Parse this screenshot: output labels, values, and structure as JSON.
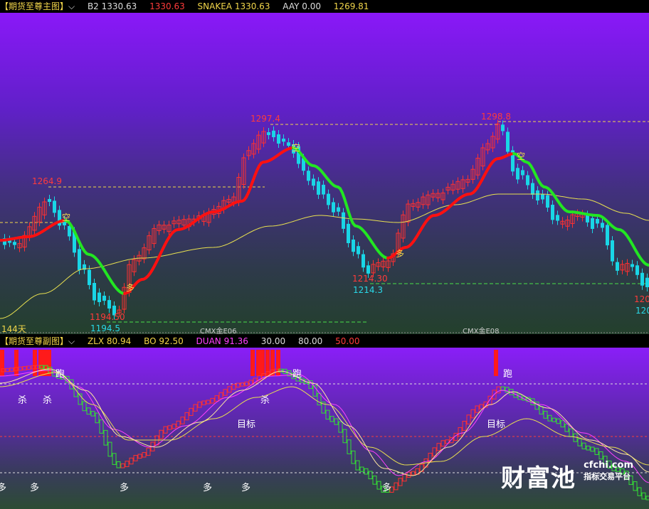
{
  "top_header": {
    "title": "【期货至尊主图】",
    "b2": "B2 1330.63",
    "red_value": "1330.63",
    "snakea": "SNAKEA 1330.63",
    "aay": "AAY 0.00",
    "last": "1269.81"
  },
  "main_labels": {
    "peak1": "1264.9",
    "peak2": "1297.4",
    "peak3": "1298.8",
    "low1_red": "1194.50",
    "low1": "1194.5",
    "low2_red": "1214.30",
    "low2": "1214.3",
    "low3_red": "120",
    "low3": "120",
    "days": "144天",
    "contract1": "CMX金E06",
    "contract2": "CMX金E08",
    "sig_kong1": "空",
    "sig_kong2": "空",
    "sig_kong3": "空",
    "sig_duo1": "多",
    "sig_duo2": "多"
  },
  "sub_header": {
    "title": "【期货至尊副图】",
    "zlx": "ZLX 80.94",
    "bo": "BO 92.50",
    "duan": "DUAN 91.36",
    "l30": "30.00",
    "l80": "80.00",
    "l50": "50.00"
  },
  "sub_labels": {
    "pao1": "跑",
    "pao2": "跑",
    "pao3": "跑",
    "sha1": "杀",
    "sha2": "杀",
    "sha3": "杀",
    "mubiao1": "目标",
    "mubiao2": "目标",
    "duo1": "多",
    "duo2": "多",
    "duo3": "多",
    "duo4": "多",
    "duo5": "多",
    "duo6": "多"
  },
  "watermark": {
    "brand": "财富池",
    "site": "cfchi.com",
    "slogan": "指标交易平台"
  },
  "colors": {
    "up": "#ff3030",
    "down": "#19d6e6",
    "sub_up": "#ff3030",
    "sub_down": "#33dd33",
    "snake_up": "#ff1010",
    "snake_down": "#22e622",
    "ma": "#e8e050"
  }
}
